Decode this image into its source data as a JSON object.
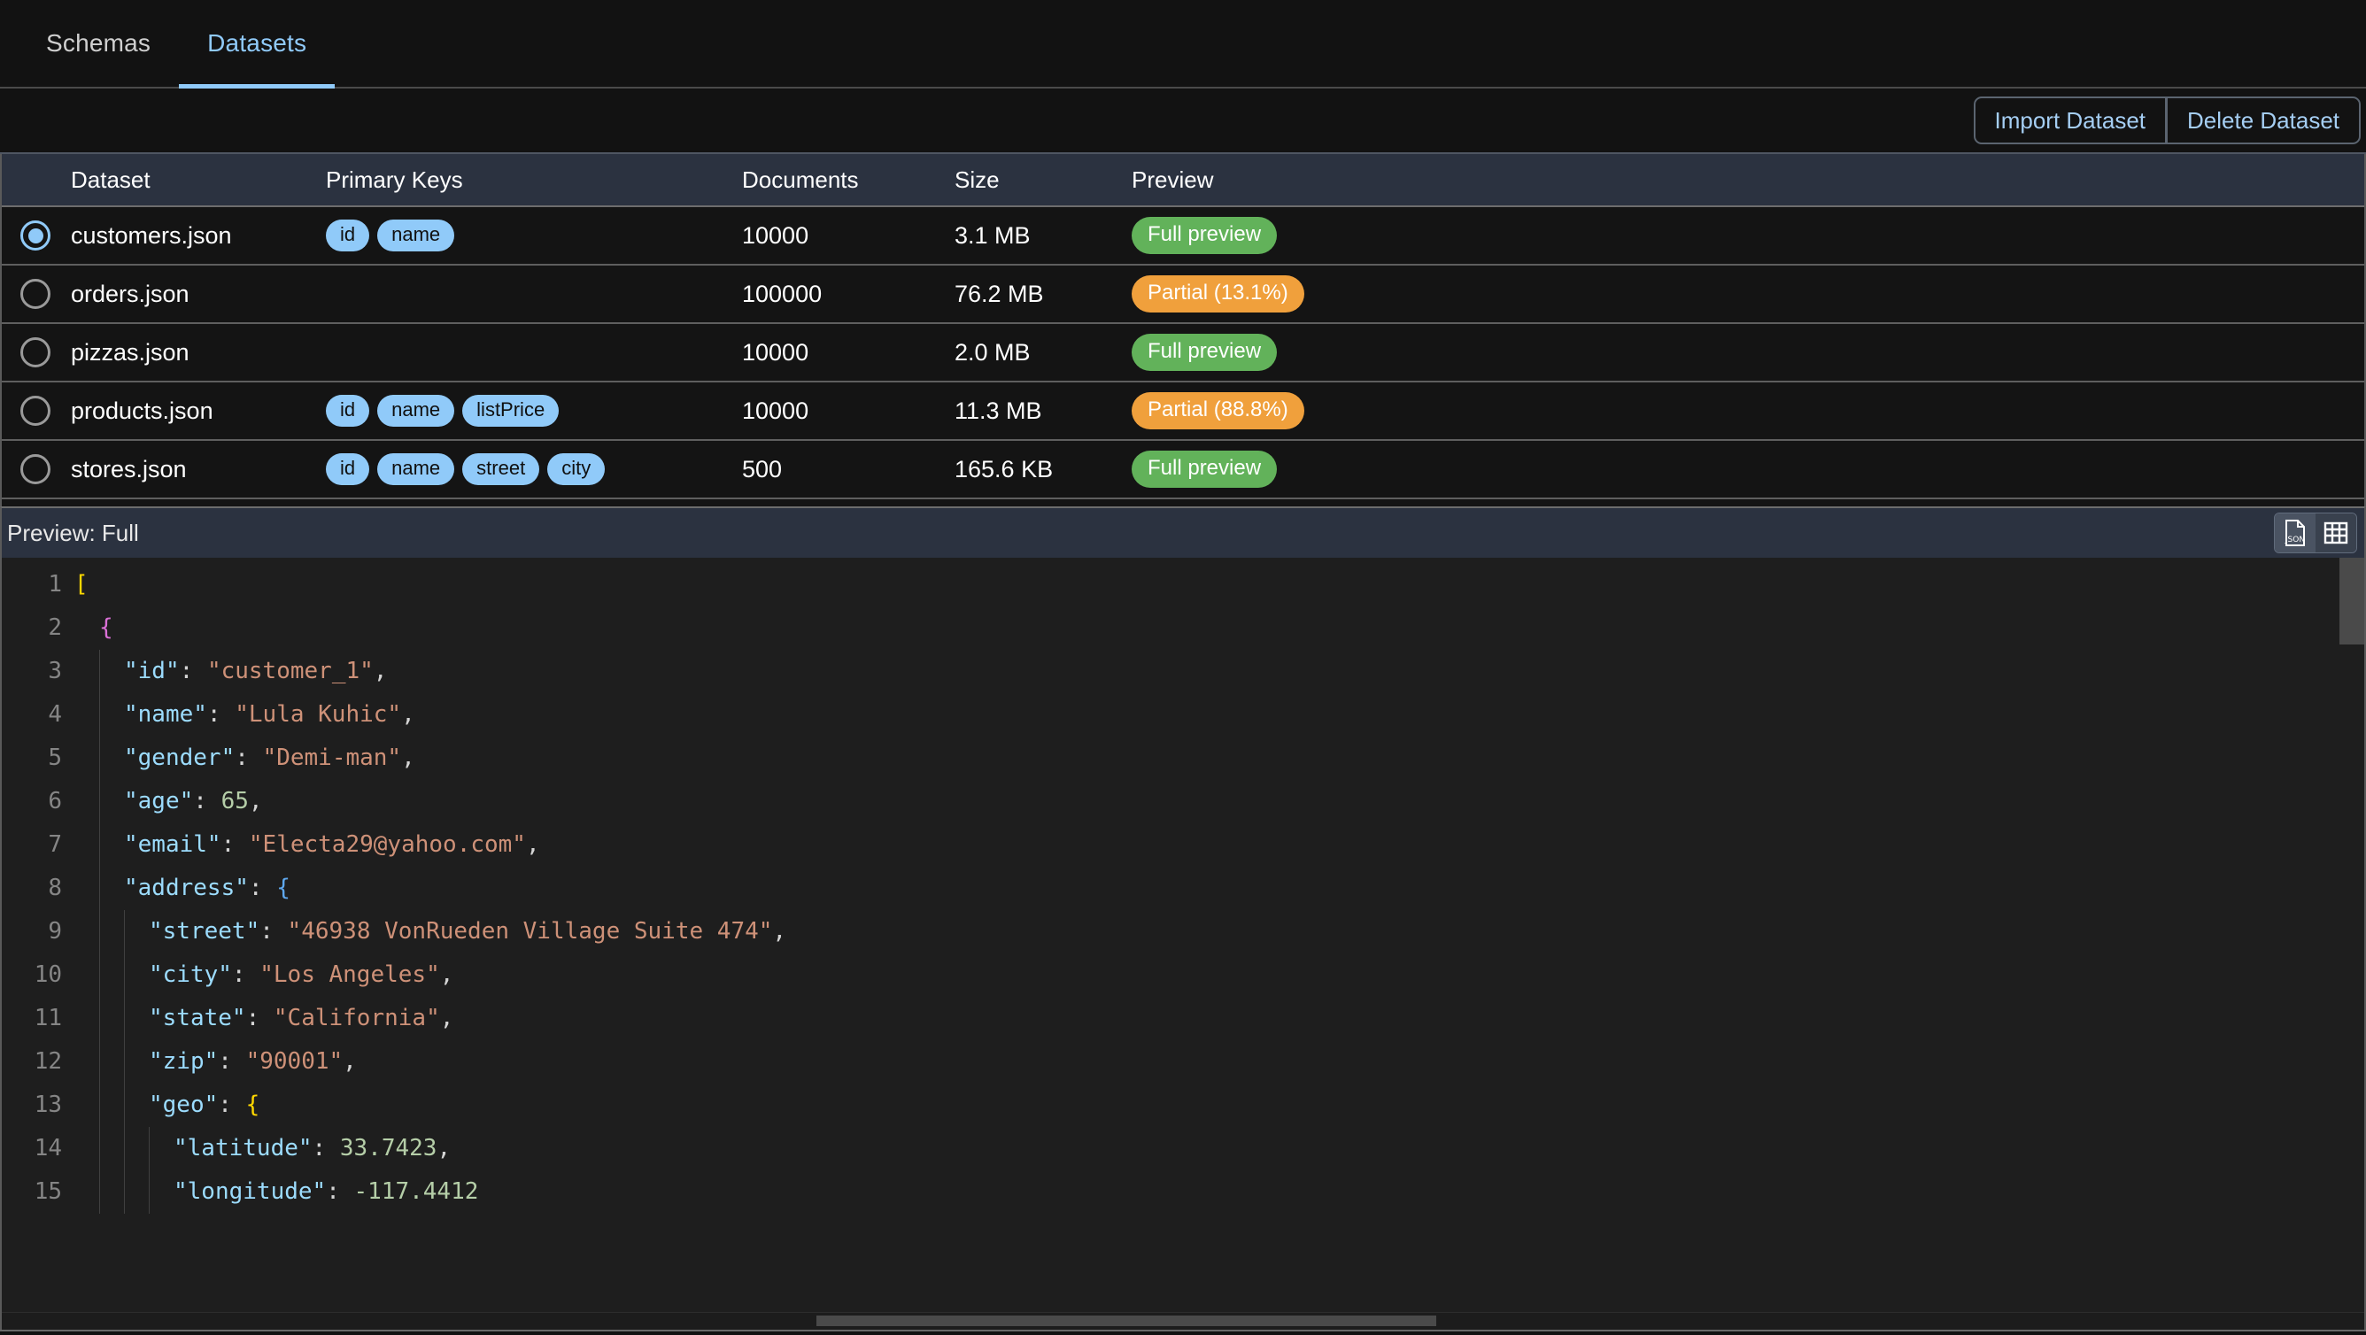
{
  "tabs": [
    {
      "label": "Schemas",
      "active": false
    },
    {
      "label": "Datasets",
      "active": true
    }
  ],
  "toolbar": {
    "import_label": "Import Dataset",
    "delete_label": "Delete Dataset"
  },
  "table": {
    "columns": [
      "Dataset",
      "Primary Keys",
      "Documents",
      "Size",
      "Preview"
    ],
    "rows": [
      {
        "selected": true,
        "name": "customers.json",
        "primary_keys": [
          "id",
          "name"
        ],
        "documents": "10000",
        "size": "3.1 MB",
        "preview_label": "Full preview",
        "preview_kind": "full"
      },
      {
        "selected": false,
        "name": "orders.json",
        "primary_keys": [],
        "documents": "100000",
        "size": "76.2 MB",
        "preview_label": "Partial (13.1%)",
        "preview_kind": "partial"
      },
      {
        "selected": false,
        "name": "pizzas.json",
        "primary_keys": [],
        "documents": "10000",
        "size": "2.0 MB",
        "preview_label": "Full preview",
        "preview_kind": "full"
      },
      {
        "selected": false,
        "name": "products.json",
        "primary_keys": [
          "id",
          "name",
          "listPrice"
        ],
        "documents": "10000",
        "size": "11.3 MB",
        "preview_label": "Partial (88.8%)",
        "preview_kind": "partial"
      },
      {
        "selected": false,
        "name": "stores.json",
        "primary_keys": [
          "id",
          "name",
          "street",
          "city"
        ],
        "documents": "500",
        "size": "165.6 KB",
        "preview_label": "Full preview",
        "preview_kind": "full"
      }
    ]
  },
  "preview": {
    "title": "Preview: Full",
    "view_json_icon": "json-file-icon",
    "view_table_icon": "table-grid-icon",
    "active_view": "json",
    "code_lines": [
      {
        "no": "1",
        "indent": 0,
        "tokens": [
          {
            "t": "[",
            "c": "b1"
          }
        ]
      },
      {
        "no": "2",
        "indent": 1,
        "tokens": [
          {
            "t": "{",
            "c": "b2"
          }
        ]
      },
      {
        "no": "3",
        "indent": 2,
        "tokens": [
          {
            "t": "\"id\"",
            "c": "k"
          },
          {
            "t": ": ",
            "c": "p"
          },
          {
            "t": "\"customer_1\"",
            "c": "s"
          },
          {
            "t": ",",
            "c": "p"
          }
        ]
      },
      {
        "no": "4",
        "indent": 2,
        "tokens": [
          {
            "t": "\"name\"",
            "c": "k"
          },
          {
            "t": ": ",
            "c": "p"
          },
          {
            "t": "\"Lula Kuhic\"",
            "c": "s"
          },
          {
            "t": ",",
            "c": "p"
          }
        ]
      },
      {
        "no": "5",
        "indent": 2,
        "tokens": [
          {
            "t": "\"gender\"",
            "c": "k"
          },
          {
            "t": ": ",
            "c": "p"
          },
          {
            "t": "\"Demi-man\"",
            "c": "s"
          },
          {
            "t": ",",
            "c": "p"
          }
        ]
      },
      {
        "no": "6",
        "indent": 2,
        "tokens": [
          {
            "t": "\"age\"",
            "c": "k"
          },
          {
            "t": ": ",
            "c": "p"
          },
          {
            "t": "65",
            "c": "n"
          },
          {
            "t": ",",
            "c": "p"
          }
        ]
      },
      {
        "no": "7",
        "indent": 2,
        "tokens": [
          {
            "t": "\"email\"",
            "c": "k"
          },
          {
            "t": ": ",
            "c": "p"
          },
          {
            "t": "\"Electa29@yahoo.com\"",
            "c": "s"
          },
          {
            "t": ",",
            "c": "p"
          }
        ]
      },
      {
        "no": "8",
        "indent": 2,
        "tokens": [
          {
            "t": "\"address\"",
            "c": "k"
          },
          {
            "t": ": ",
            "c": "p"
          },
          {
            "t": "{",
            "c": "b3"
          }
        ]
      },
      {
        "no": "9",
        "indent": 3,
        "tokens": [
          {
            "t": "\"street\"",
            "c": "k"
          },
          {
            "t": ": ",
            "c": "p"
          },
          {
            "t": "\"46938 VonRueden Village Suite 474\"",
            "c": "s"
          },
          {
            "t": ",",
            "c": "p"
          }
        ]
      },
      {
        "no": "10",
        "indent": 3,
        "tokens": [
          {
            "t": "\"city\"",
            "c": "k"
          },
          {
            "t": ": ",
            "c": "p"
          },
          {
            "t": "\"Los Angeles\"",
            "c": "s"
          },
          {
            "t": ",",
            "c": "p"
          }
        ]
      },
      {
        "no": "11",
        "indent": 3,
        "tokens": [
          {
            "t": "\"state\"",
            "c": "k"
          },
          {
            "t": ": ",
            "c": "p"
          },
          {
            "t": "\"California\"",
            "c": "s"
          },
          {
            "t": ",",
            "c": "p"
          }
        ]
      },
      {
        "no": "12",
        "indent": 3,
        "tokens": [
          {
            "t": "\"zip\"",
            "c": "k"
          },
          {
            "t": ": ",
            "c": "p"
          },
          {
            "t": "\"90001\"",
            "c": "s"
          },
          {
            "t": ",",
            "c": "p"
          }
        ]
      },
      {
        "no": "13",
        "indent": 3,
        "tokens": [
          {
            "t": "\"geo\"",
            "c": "k"
          },
          {
            "t": ": ",
            "c": "p"
          },
          {
            "t": "{",
            "c": "b1"
          }
        ]
      },
      {
        "no": "14",
        "indent": 4,
        "tokens": [
          {
            "t": "\"latitude\"",
            "c": "k"
          },
          {
            "t": ": ",
            "c": "p"
          },
          {
            "t": "33.7423",
            "c": "n"
          },
          {
            "t": ",",
            "c": "p"
          }
        ]
      },
      {
        "no": "15",
        "indent": 4,
        "tokens": [
          {
            "t": "\"longitude\"",
            "c": "k"
          },
          {
            "t": ": ",
            "c": "p"
          },
          {
            "t": "-117.4412",
            "c": "n"
          }
        ]
      }
    ]
  },
  "colors": {
    "accent": "#90caf9",
    "full_preview": "#62b25a",
    "partial_preview": "#f0a03c",
    "header_bg": "#2b3240",
    "page_bg": "#121212"
  }
}
